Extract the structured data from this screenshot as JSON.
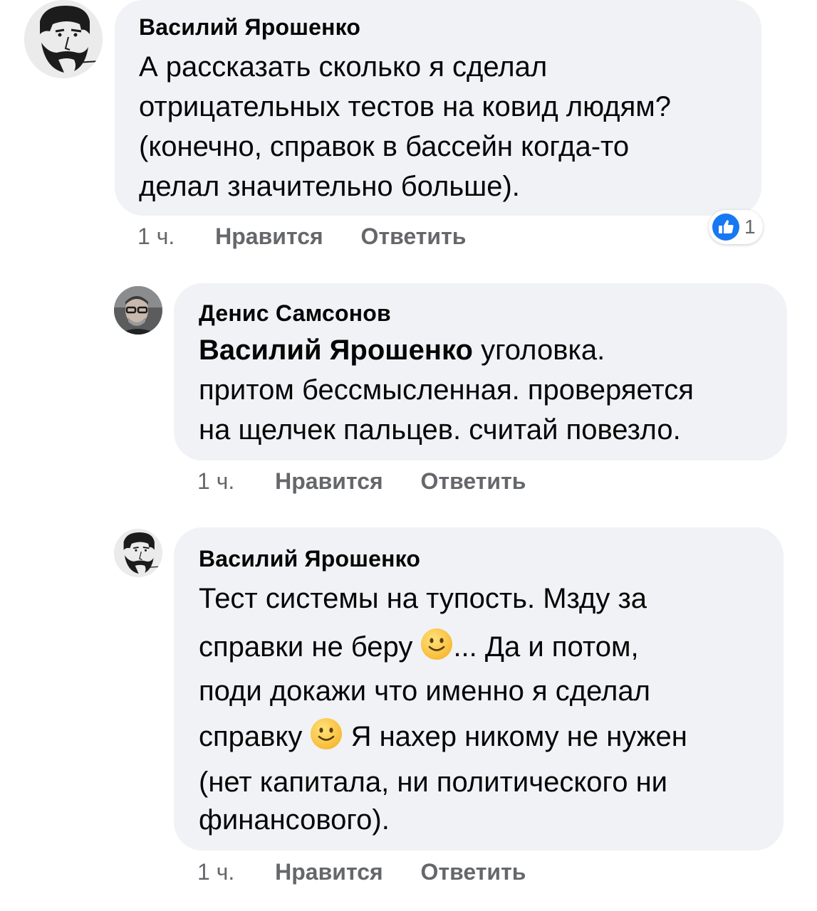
{
  "comments": [
    {
      "author": "Василий Ярошенко",
      "lines": [
        "А рассказать сколько я сделал",
        "отрицательных тестов на ковид людям?",
        "(конечно, справок в бассейн когда-то",
        "делал значительно больше)."
      ],
      "time": "1 ч.",
      "like_label": "Нравится",
      "reply_label": "Ответить",
      "reaction": {
        "icon": "like-icon",
        "count": "1",
        "color": "#1877f2"
      }
    },
    {
      "author": "Денис Самсонов",
      "mention": "Василий Ярошенко",
      "lines": [
        " уголовка.",
        "притом бессмысленная. проверяется",
        "на щелчек пальцев. считай повезло."
      ],
      "time": "1 ч.",
      "like_label": "Нравится",
      "reply_label": "Ответить"
    },
    {
      "author": "Василий Ярошенко",
      "lines": [
        "Тест системы на тупость. Мзду за",
        "справки не беру ",
        "... Да и потом,",
        "поди докажи что именно я сделал",
        "справку ",
        " Я нахер никому не нужен",
        "(нет капитала, ни политического ни",
        "финансового)."
      ],
      "emoji": "slightly-smiling-face-icon",
      "time": "1 ч.",
      "like_label": "Нравится",
      "reply_label": "Ответить"
    }
  ]
}
